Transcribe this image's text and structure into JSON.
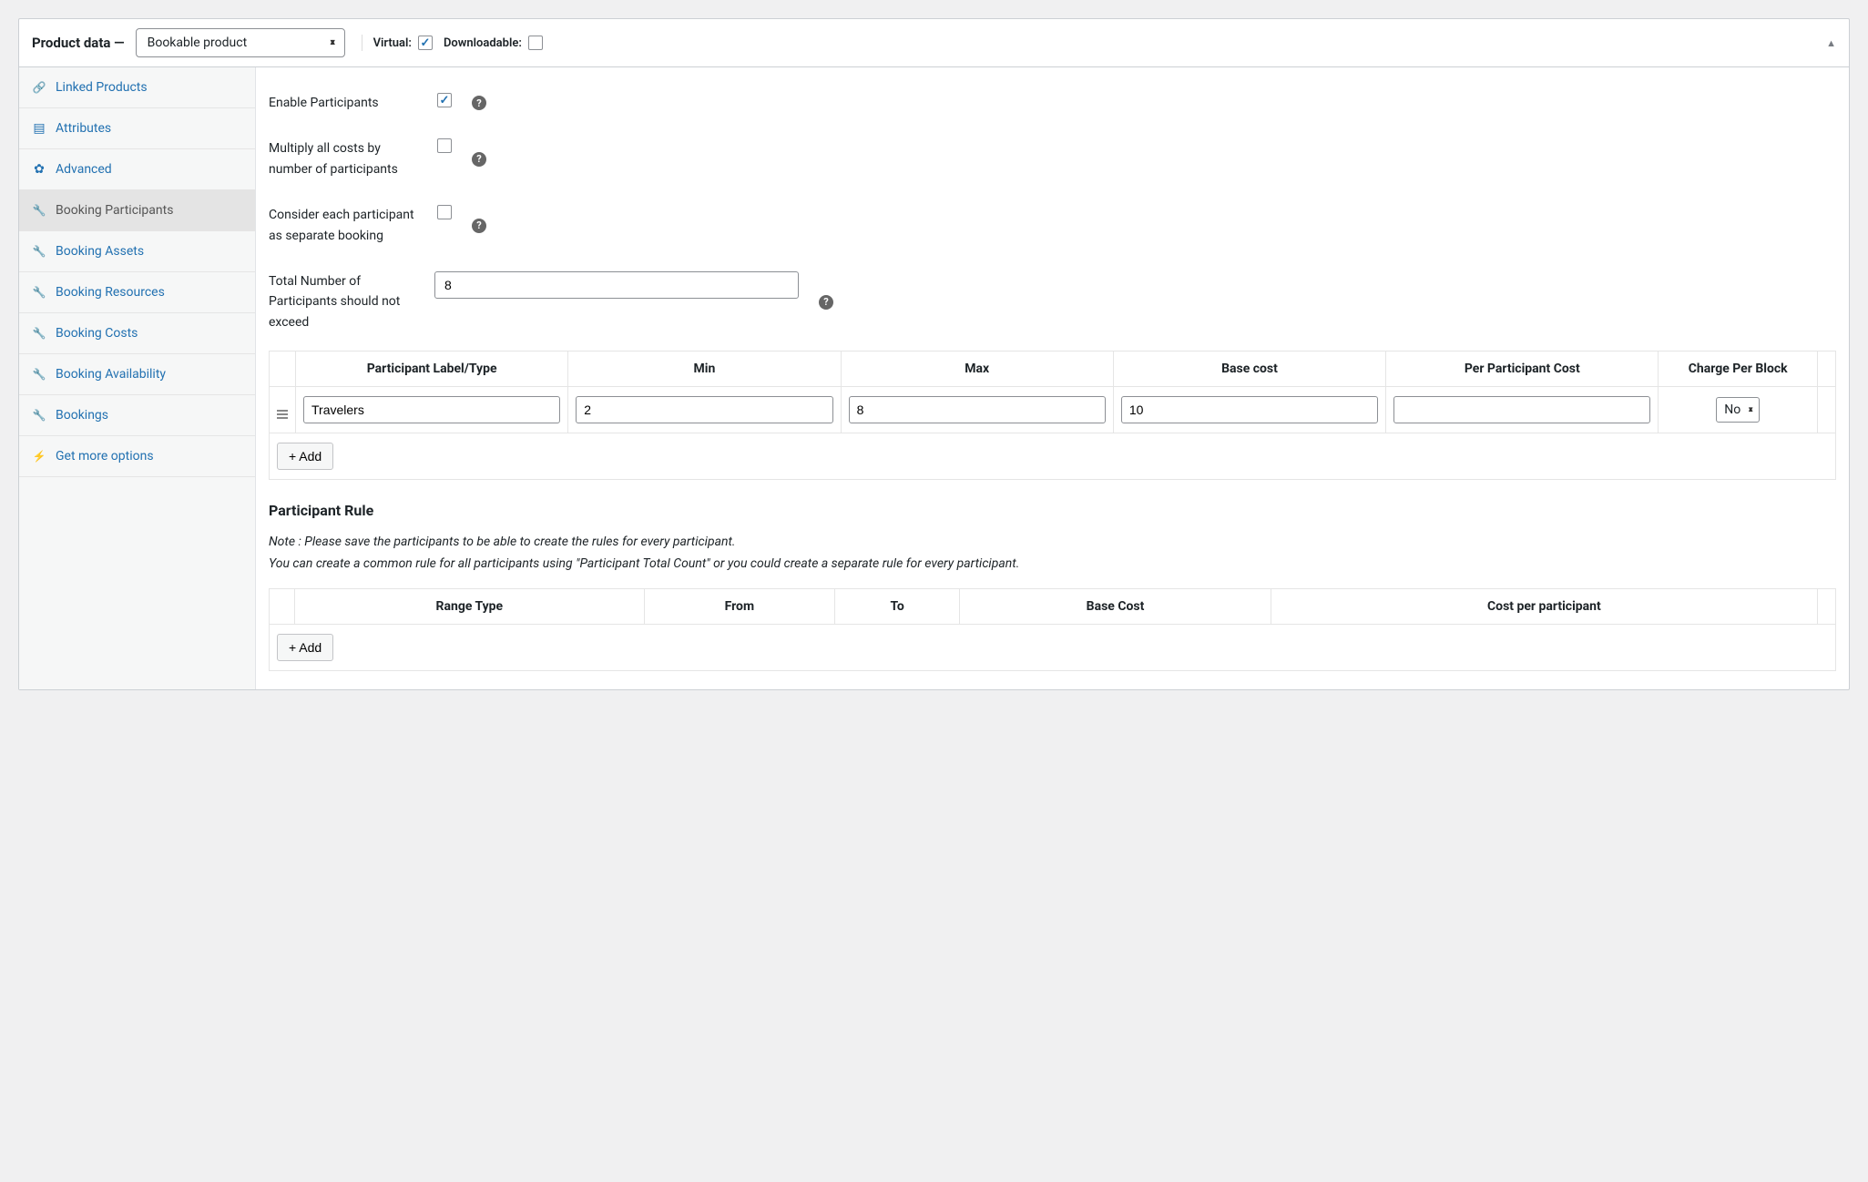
{
  "header": {
    "title": "Product data —",
    "product_type": "Bookable product",
    "virtual_label": "Virtual:",
    "virtual_checked": true,
    "downloadable_label": "Downloadable:",
    "downloadable_checked": false
  },
  "tabs": [
    {
      "icon": "link-icon",
      "label": "Linked Products",
      "active": false
    },
    {
      "icon": "layout-icon",
      "label": "Attributes",
      "active": false
    },
    {
      "icon": "gear-icon",
      "label": "Advanced",
      "active": false
    },
    {
      "icon": "wrench-icon",
      "label": "Booking Participants",
      "active": true
    },
    {
      "icon": "wrench-icon",
      "label": "Booking Assets",
      "active": false
    },
    {
      "icon": "wrench-icon",
      "label": "Booking Resources",
      "active": false
    },
    {
      "icon": "wrench-icon",
      "label": "Booking Costs",
      "active": false
    },
    {
      "icon": "wrench-icon",
      "label": "Booking Availability",
      "active": false
    },
    {
      "icon": "wrench-icon",
      "label": "Bookings",
      "active": false
    },
    {
      "icon": "plug-icon",
      "label": "Get more options",
      "active": false
    }
  ],
  "form": {
    "enable_participants_label": "Enable Participants",
    "multiply_costs_label": "Multiply all costs by number of participants",
    "separate_booking_label": "Consider each participant as separate booking",
    "max_participants_label": "Total Number of Participants should not exceed",
    "max_participants_value": "8"
  },
  "participants_table": {
    "headers": {
      "label": "Participant Label/Type",
      "min": "Min",
      "max": "Max",
      "base_cost": "Base cost",
      "per_participant_cost": "Per Participant Cost",
      "charge_per_block": "Charge Per Block"
    },
    "rows": [
      {
        "label": "Travelers",
        "min": "2",
        "max": "8",
        "base_cost": "10",
        "per_participant_cost": "",
        "charge_per_block": "No"
      }
    ],
    "add_label": "+ Add"
  },
  "rule_section": {
    "heading": "Participant Rule",
    "note_line1": "Note : Please save the participants to be able to create the rules for every participant.",
    "note_line2": "You can create a common rule for all participants using \"Participant Total Count\" or you could create a separate rule for every participant.",
    "headers": {
      "range_type": "Range Type",
      "from": "From",
      "to": "To",
      "base_cost": "Base Cost",
      "cost_per_participant": "Cost per participant"
    },
    "add_label": "+ Add"
  },
  "help_glyph": "?"
}
